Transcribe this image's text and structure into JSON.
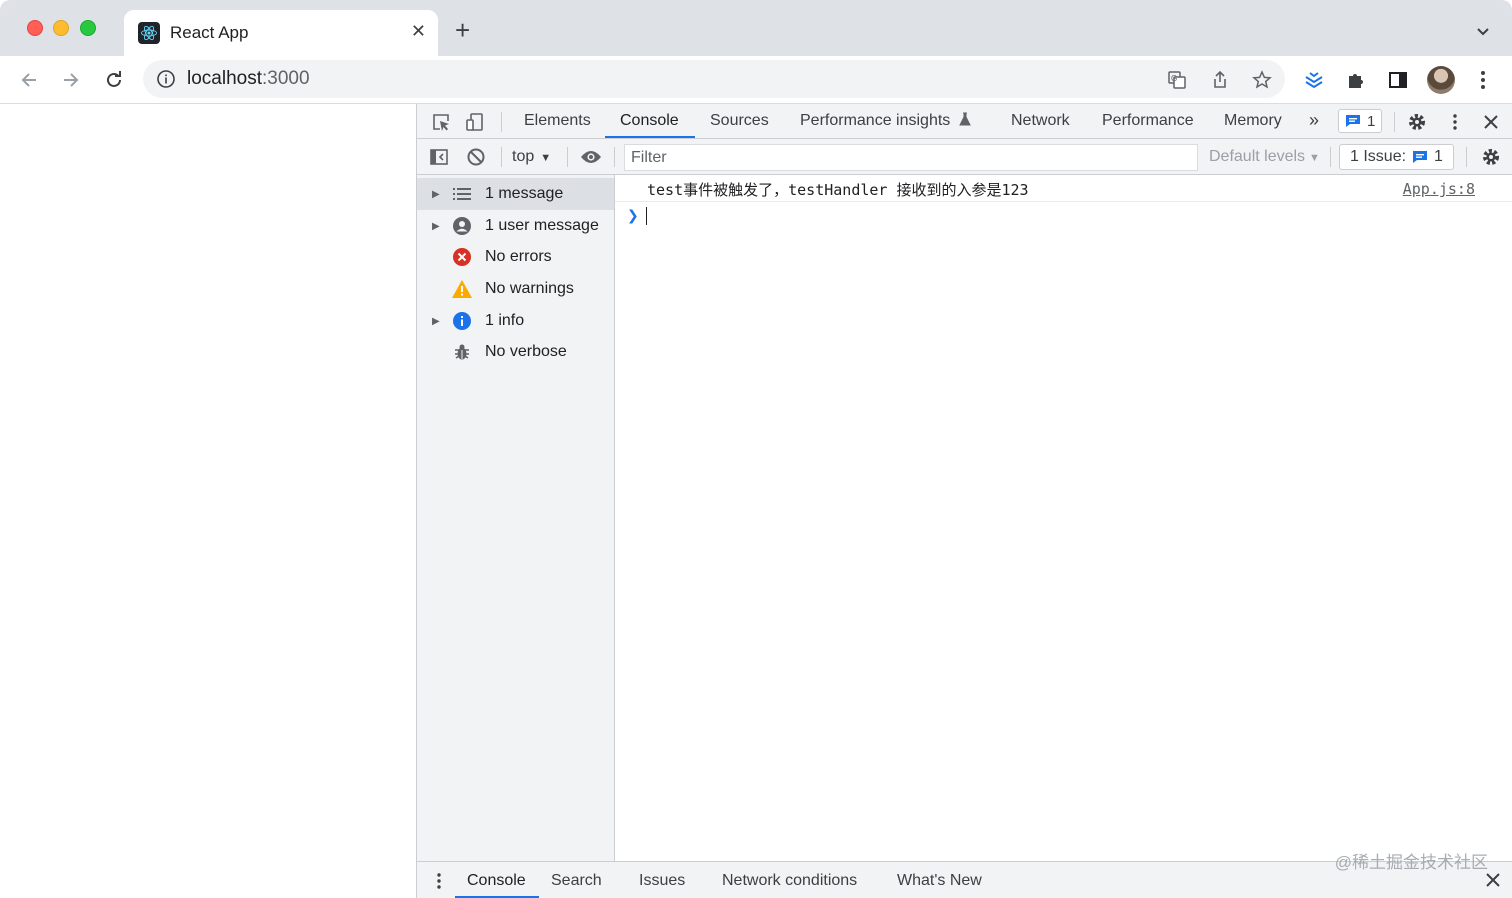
{
  "browser": {
    "tab": {
      "title": "React App",
      "favicon": "react-logo-icon"
    },
    "address": {
      "host": "localhost",
      "port": ":3000"
    }
  },
  "devtools": {
    "tabs": [
      {
        "label": "Elements"
      },
      {
        "label": "Console",
        "active": true
      },
      {
        "label": "Sources"
      },
      {
        "label": "Performance insights"
      },
      {
        "label": "Network"
      },
      {
        "label": "Performance"
      },
      {
        "label": "Memory"
      }
    ],
    "messages_badge": "1",
    "filterbar": {
      "context": "top",
      "filter_placeholder": "Filter",
      "levels": "Default levels",
      "issues_label": "1 Issue:",
      "issues_count": "1"
    },
    "sidebar": [
      {
        "label": "1 message",
        "icon": "list-icon",
        "expandable": true,
        "selected": true
      },
      {
        "label": "1 user message",
        "icon": "user-icon",
        "expandable": true
      },
      {
        "label": "No errors",
        "icon": "error-icon",
        "expandable": false
      },
      {
        "label": "No warnings",
        "icon": "warning-icon",
        "expandable": false
      },
      {
        "label": "1 info",
        "icon": "info-icon",
        "expandable": true
      },
      {
        "label": "No verbose",
        "icon": "bug-icon",
        "expandable": false
      }
    ],
    "console": {
      "log_message": "test事件被触发了，testHandler 接收到的入参是123",
      "log_source": "App.js:8"
    },
    "drawer": {
      "tabs": [
        "Console",
        "Search",
        "Issues",
        "Network conditions",
        "What's New"
      ]
    }
  },
  "watermark": "@稀土掘金技术社区",
  "colors": {
    "accent": "#1a73e8",
    "error": "#d93025",
    "warning": "#f9ab00",
    "info": "#1a73e8"
  }
}
